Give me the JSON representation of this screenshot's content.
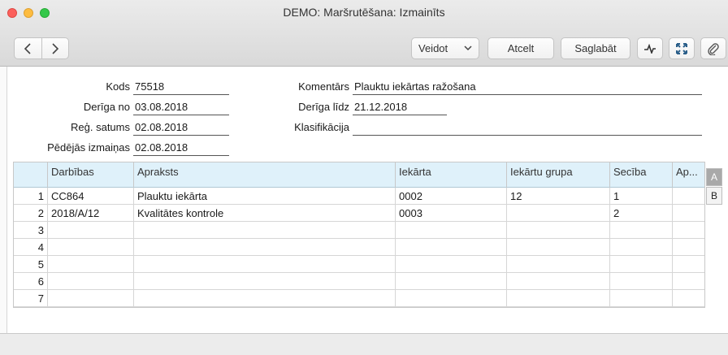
{
  "window": {
    "title": "DEMO: Maršrutēšana: Izmainīts"
  },
  "toolbar": {
    "back_icon": "chevron-left-icon",
    "forward_icon": "chevron-right-icon",
    "create_label": "Veidot",
    "cancel_label": "Atcelt",
    "save_label": "Saglabāt",
    "icons": [
      "activity-icon",
      "expand-icon",
      "paperclip-icon"
    ]
  },
  "form": {
    "code": {
      "label": "Kods",
      "value": "75518"
    },
    "valid_from": {
      "label": "Derīga no",
      "value": "03.08.2018"
    },
    "reg_date": {
      "label": "Reģ. satums",
      "value": "02.08.2018"
    },
    "last_change": {
      "label": "Pēdējās izmaiņas",
      "value": "02.08.2018"
    },
    "comment": {
      "label": "Komentārs",
      "value": "Plauktu iekārtas ražošana"
    },
    "valid_to": {
      "label": "Derīga līdz",
      "value": "21.12.2018"
    },
    "classification": {
      "label": "Klasifikācija",
      "value": ""
    }
  },
  "grid": {
    "headers": [
      "",
      "Darbības",
      "Apraksts",
      "Iekārta",
      "Iekārtu grupa",
      "Secība",
      "Ap..."
    ],
    "rows": [
      [
        "1",
        "CC864",
        "Plauktu iekārta",
        "0002",
        "12",
        "1",
        ""
      ],
      [
        "2",
        "2018/A/12",
        "Kvalitātes kontrole",
        "0003",
        "",
        "2",
        ""
      ],
      [
        "3",
        "",
        "",
        "",
        "",
        "",
        ""
      ],
      [
        "4",
        "",
        "",
        "",
        "",
        "",
        ""
      ],
      [
        "5",
        "",
        "",
        "",
        "",
        "",
        ""
      ],
      [
        "6",
        "",
        "",
        "",
        "",
        "",
        ""
      ],
      [
        "7",
        "",
        "",
        "",
        "",
        "",
        ""
      ]
    ]
  },
  "side_tabs": [
    "A",
    "B"
  ]
}
